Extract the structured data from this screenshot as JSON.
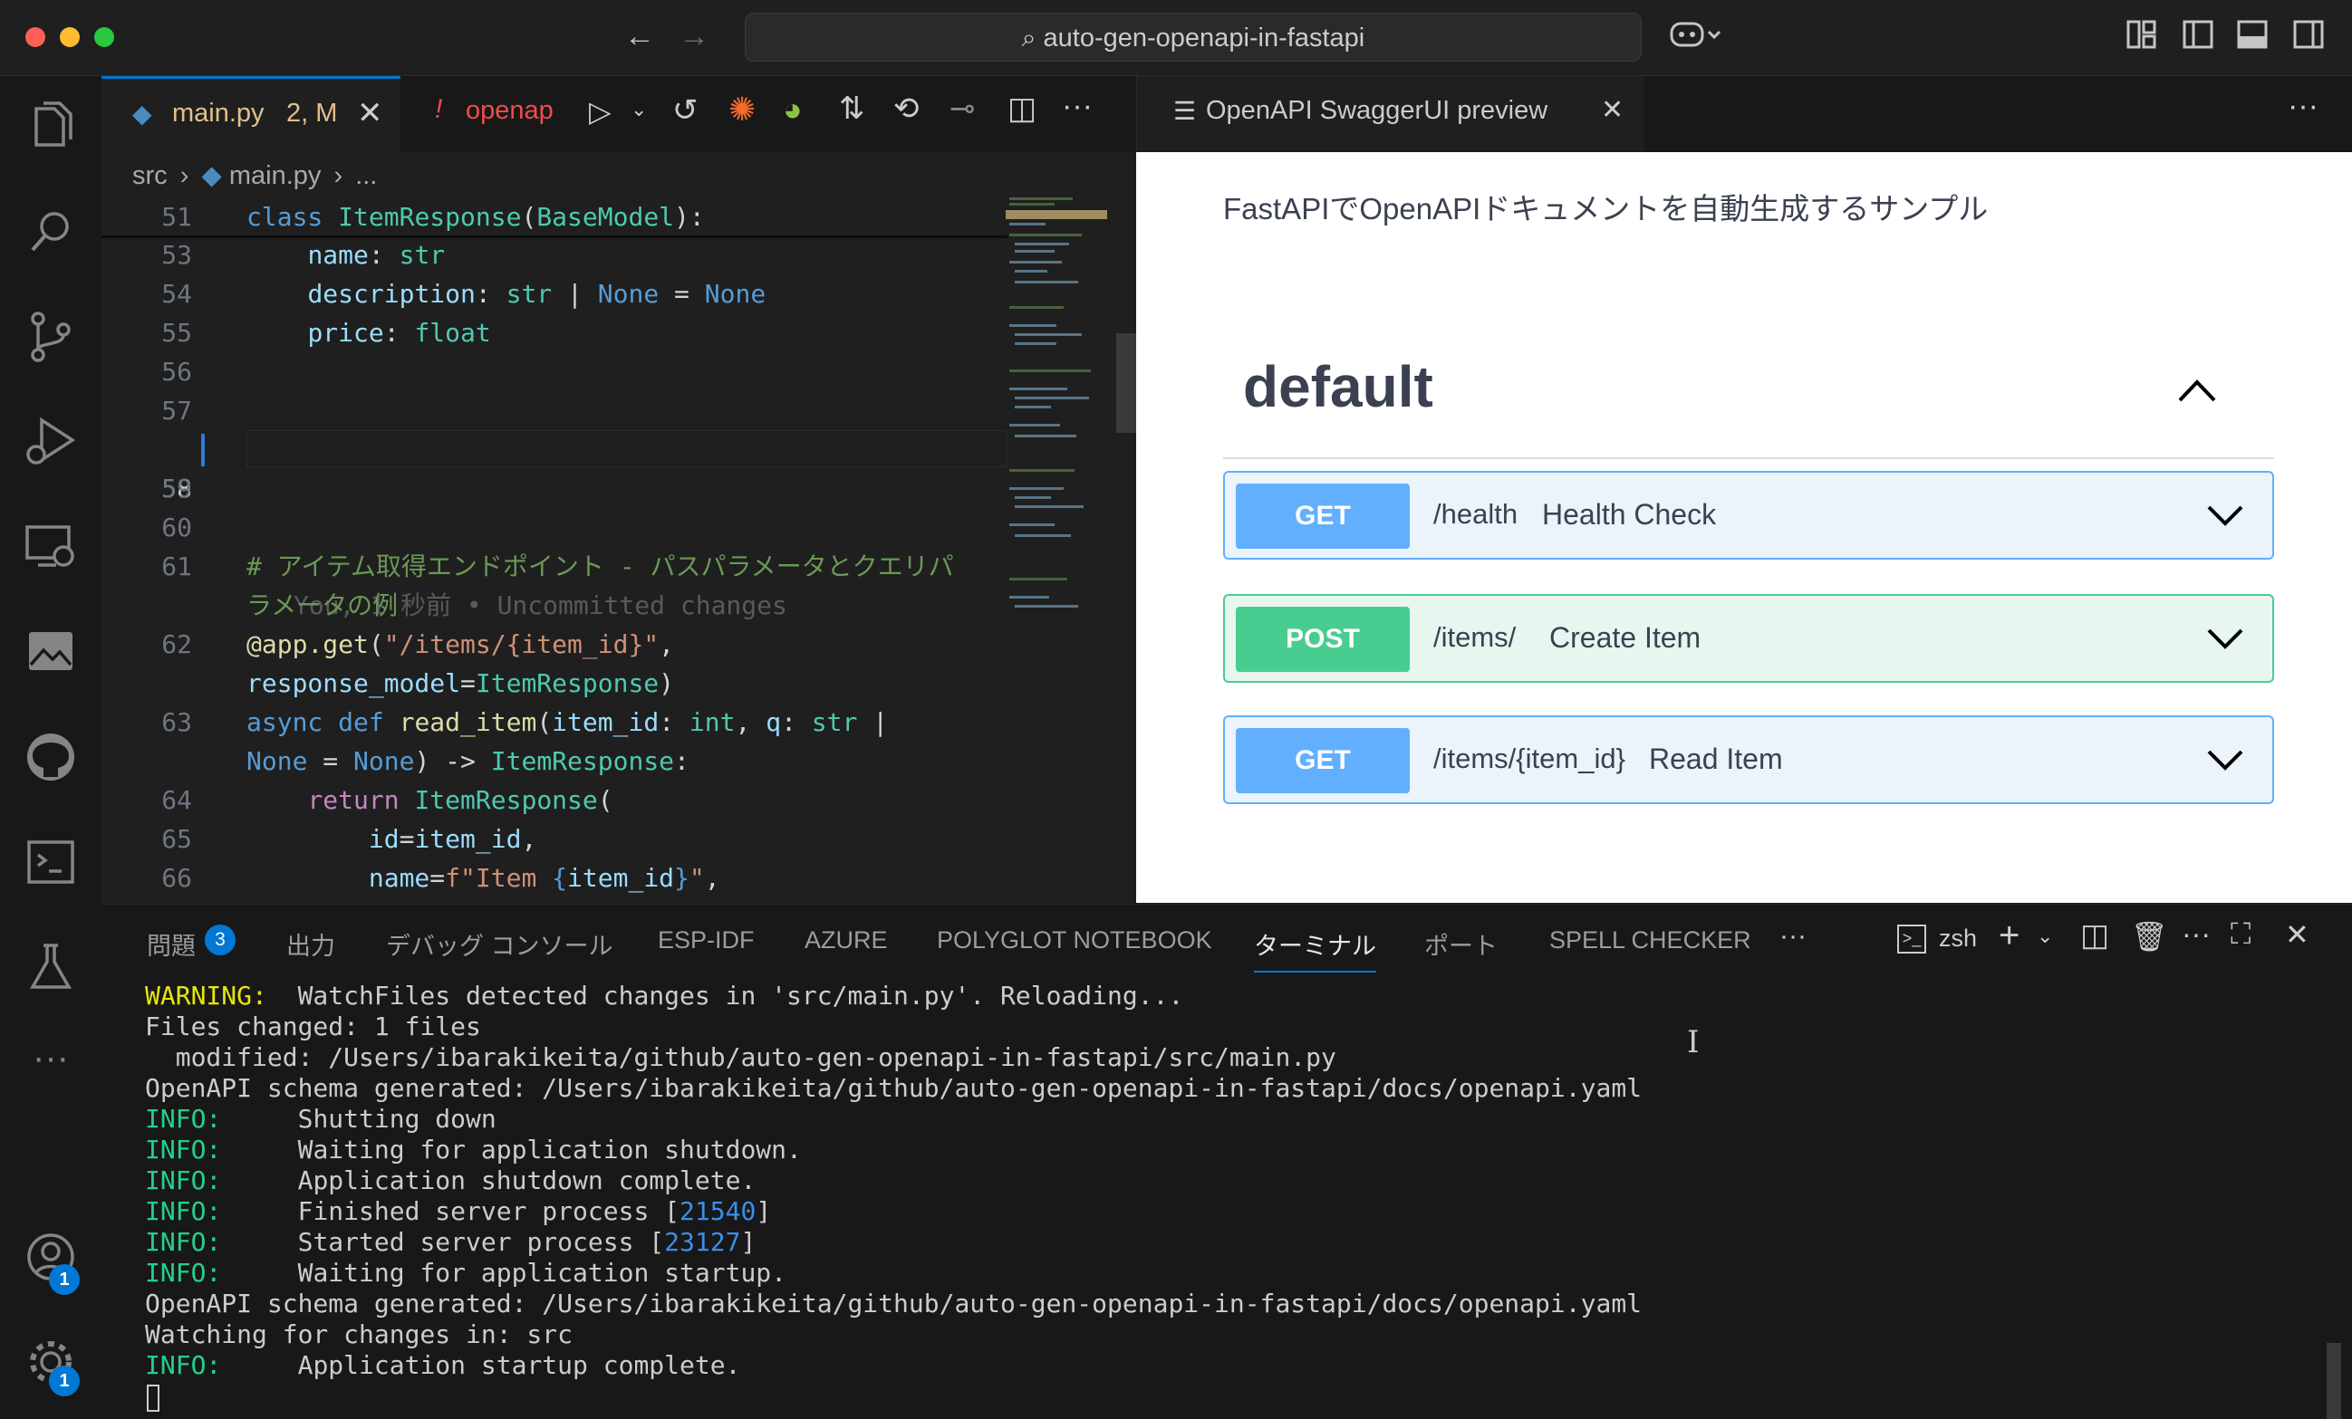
{
  "titlebar": {
    "search_text": "auto-gen-openapi-in-fastapi"
  },
  "editor": {
    "tabs": [
      {
        "label": "main.py",
        "status": "2, M"
      },
      {
        "label": "openap"
      }
    ],
    "breadcrumb": [
      "src",
      "main.py",
      "..."
    ],
    "blame_text": "You, 1 秒前 • Uncommitted changes",
    "lines": [
      {
        "n": "51",
        "code": "class ItemResponse(BaseModel):"
      },
      {
        "n": "53",
        "code": "    name: str"
      },
      {
        "n": "54",
        "code": "    description: str | None = None"
      },
      {
        "n": "55",
        "code": "    price: float"
      },
      {
        "n": "56",
        "code": ""
      },
      {
        "n": "57",
        "code": ""
      },
      {
        "n": "58",
        "code": ""
      },
      {
        "n": "59",
        "code": ""
      },
      {
        "n": "60",
        "code": ""
      },
      {
        "n": "61",
        "code": "# アイテム取得エンドポイント - パスパラメータとクエリパ"
      },
      {
        "n": "",
        "code": "ラメータの例"
      },
      {
        "n": "62",
        "code": "@app.get(\"/items/{item_id}\","
      },
      {
        "n": "",
        "code": "response_model=ItemResponse)"
      },
      {
        "n": "63",
        "code": "async def read_item(item_id: int, q: str |"
      },
      {
        "n": "",
        "code": "None = None) -> ItemResponse:"
      },
      {
        "n": "64",
        "code": "    return ItemResponse("
      },
      {
        "n": "65",
        "code": "        id=item_id,"
      },
      {
        "n": "66",
        "code": "        name=f\"Item {item_id}\","
      }
    ]
  },
  "preview": {
    "tab_label": "OpenAPI SwaggerUI preview",
    "description": "FastAPIでOpenAPIドキュメントを自動生成するサンプル",
    "section_title": "default",
    "operations": [
      {
        "method": "GET",
        "path": "/health",
        "summary": "Health Check",
        "color": "#61affe",
        "bg": "#ebf3fb"
      },
      {
        "method": "POST",
        "path": "/items/",
        "summary": "Create Item",
        "color": "#49cc90",
        "bg": "#e8f6f0"
      },
      {
        "method": "GET",
        "path": "/items/{item_id}",
        "summary": "Read Item",
        "color": "#61affe",
        "bg": "#ebf3fb"
      }
    ]
  },
  "panel": {
    "tabs": [
      "問題",
      "出力",
      "デバッグ コンソール",
      "ESP-IDF",
      "AZURE",
      "POLYGLOT NOTEBOOK",
      "ターミナル",
      "ポート",
      "SPELL CHECKER"
    ],
    "problems_count": "3",
    "active_tab": "ターミナル",
    "shell": "zsh",
    "terminal": [
      {
        "prefix": "WARNING:",
        "text": "  WatchFiles detected changes in 'src/main.py'. Reloading..."
      },
      {
        "prefix": "",
        "text": "Files changed: 1 files"
      },
      {
        "prefix": "",
        "text": "  modified: /Users/ibarakikeita/github/auto-gen-openapi-in-fastapi/src/main.py"
      },
      {
        "prefix": "",
        "text": "OpenAPI schema generated: /Users/ibarakikeita/github/auto-gen-openapi-in-fastapi/docs/openapi.yaml"
      },
      {
        "prefix": "INFO:",
        "text": "     Shutting down"
      },
      {
        "prefix": "INFO:",
        "text": "     Waiting for application shutdown."
      },
      {
        "prefix": "INFO:",
        "text": "     Application shutdown complete."
      },
      {
        "prefix": "INFO:",
        "text": "     Finished server process [",
        "num": "21540",
        "tail": "]"
      },
      {
        "prefix": "INFO:",
        "text": "     Started server process [",
        "num": "23127",
        "tail": "]"
      },
      {
        "prefix": "INFO:",
        "text": "     Waiting for application startup."
      },
      {
        "prefix": "",
        "text": "OpenAPI schema generated: /Users/ibarakikeita/github/auto-gen-openapi-in-fastapi/docs/openapi.yaml"
      },
      {
        "prefix": "",
        "text": "Watching for changes in: src"
      },
      {
        "prefix": "INFO:",
        "text": "     Application startup complete."
      }
    ]
  },
  "activity_badges": {
    "accounts": "1",
    "manage": "1"
  }
}
